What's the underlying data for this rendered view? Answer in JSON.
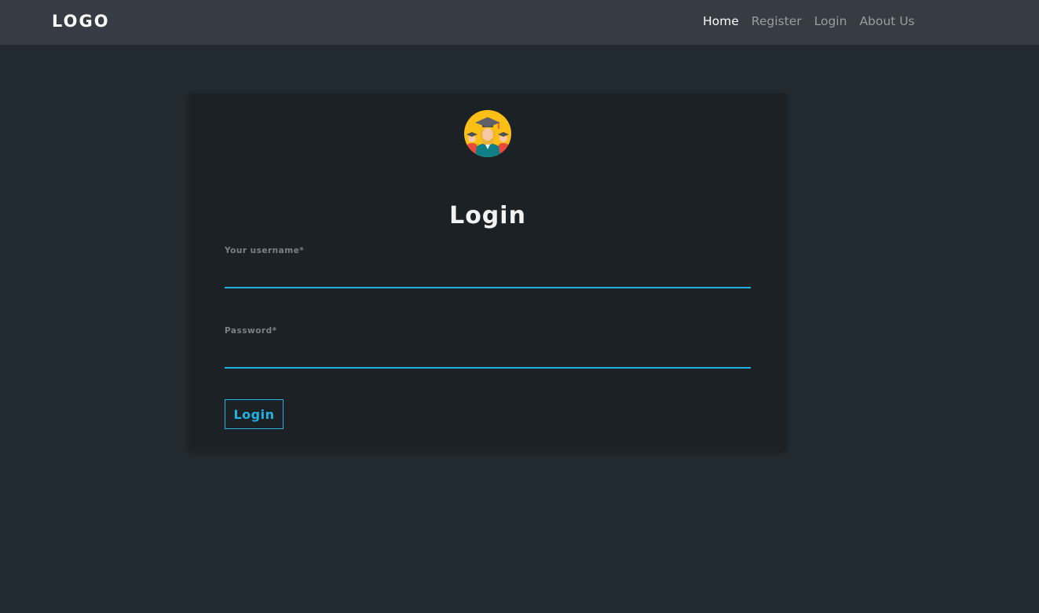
{
  "navbar": {
    "logo": "LOGO",
    "links": [
      {
        "label": "Home",
        "active": true
      },
      {
        "label": "Register",
        "active": false
      },
      {
        "label": "Login",
        "active": false
      },
      {
        "label": "About Us",
        "active": false
      }
    ]
  },
  "form": {
    "avatar_icon": "graduates-icon",
    "title": "Login",
    "username": {
      "label": "Your username*",
      "value": "",
      "placeholder": ""
    },
    "password": {
      "label": "Password*",
      "value": "",
      "placeholder": ""
    },
    "submit_label": "Login"
  },
  "colors": {
    "page_background": "#222b31",
    "navbar_background": "#373b43",
    "card_background": "#1c2125",
    "accent": "#1fb2e3",
    "avatar_yellow": "#fbbf16",
    "avatar_teal": "#0f7f86"
  }
}
